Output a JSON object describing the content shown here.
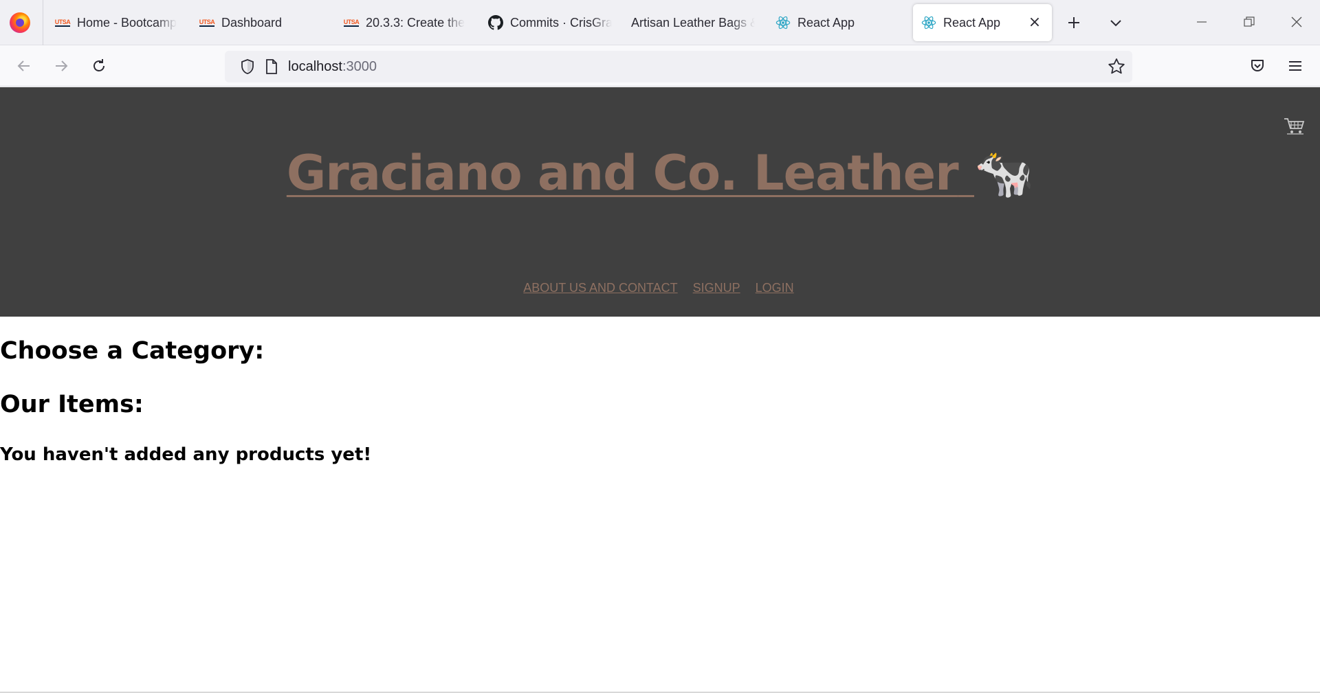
{
  "browser": {
    "tabs": [
      {
        "label": "Home - Bootcamp",
        "icon": "utsa-icon",
        "utsa_text": "UTSA"
      },
      {
        "label": "Dashboard",
        "icon": "utsa-icon",
        "utsa_text": "UTSA"
      },
      {
        "label": "20.3.3: Create the",
        "icon": "utsa-icon",
        "utsa_text": "UTSA"
      },
      {
        "label": "Commits · CrisGra",
        "icon": "github-icon"
      },
      {
        "label": "Artisan Leather Bags &",
        "icon": "none"
      },
      {
        "label": "React App",
        "icon": "react-icon"
      },
      {
        "label": "React App",
        "icon": "react-icon",
        "active": true
      }
    ],
    "url_host": "localhost",
    "url_port": ":3000"
  },
  "site": {
    "title": "Graciano and Co. Leather",
    "title_emoji": "🐄",
    "nav": [
      {
        "label": "ABOUT US AND CONTACT"
      },
      {
        "label": "SIGNUP"
      },
      {
        "label": "LOGIN"
      }
    ],
    "colors": {
      "header_bg": "#404040",
      "brand": "#8e7061"
    }
  },
  "main": {
    "category_heading": "Choose a Category:",
    "items_heading": "Our Items:",
    "empty_message": "You haven't added any products yet!"
  }
}
